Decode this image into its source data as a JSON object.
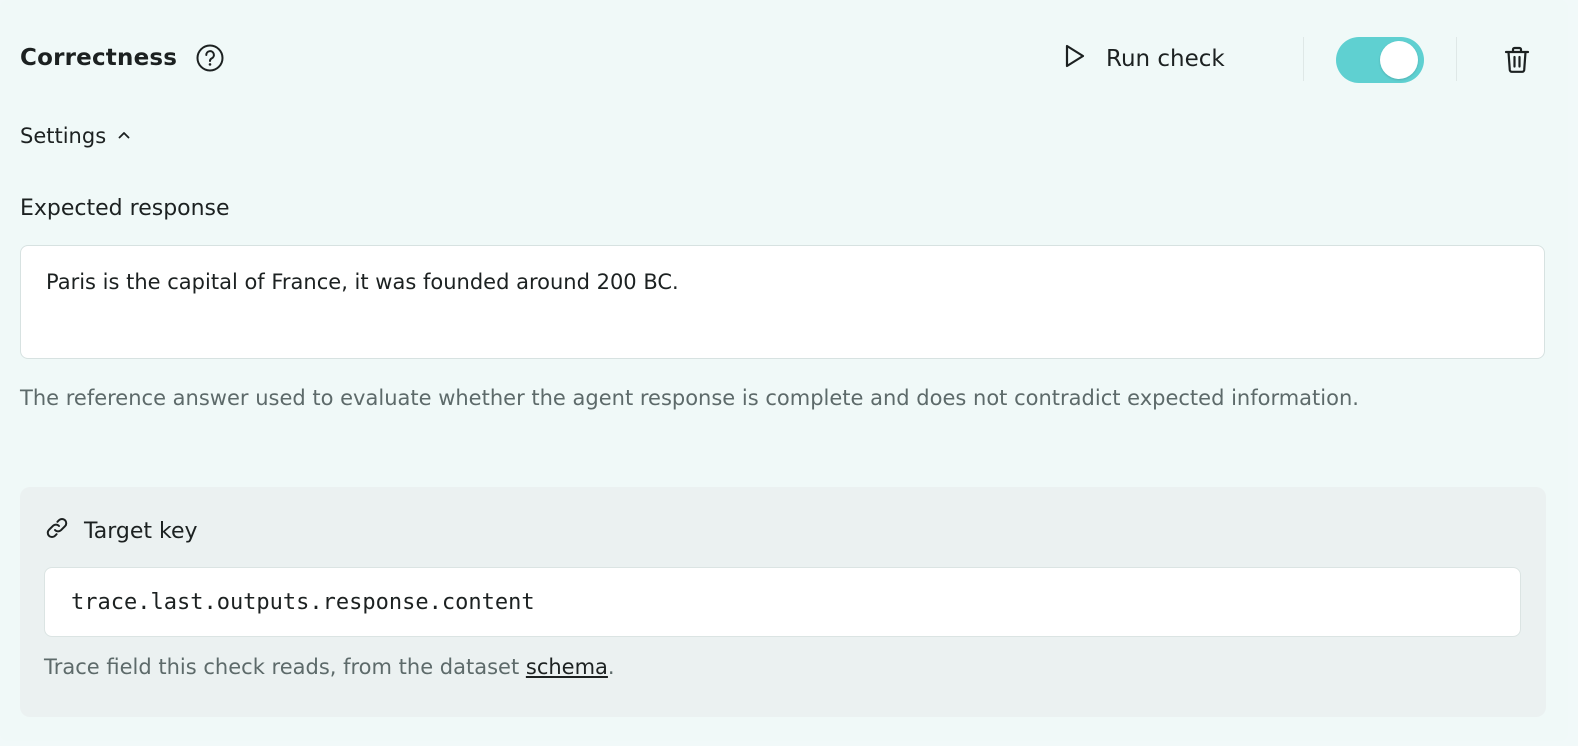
{
  "header": {
    "title": "Correctness",
    "run_check_label": "Run check",
    "toggle_on": true,
    "accent_color": "#5fd0d1"
  },
  "icons": {
    "help": "question-circle-icon",
    "run": "play-icon",
    "delete": "trash-icon",
    "settings_chevron": "chevron-up-icon",
    "target": "link-icon"
  },
  "settings": {
    "label": "Settings",
    "expanded": true
  },
  "expected_response": {
    "label": "Expected response",
    "value": "Paris is the capital of France, it was founded around 200 BC.",
    "helper": "The reference answer used to evaluate whether the agent response is complete and does not contradict expected information."
  },
  "target_key": {
    "label": "Target key",
    "value": "trace.last.outputs.response.content",
    "help_prefix": "Trace field this check reads, from the dataset ",
    "help_link": "schema",
    "help_suffix": "."
  }
}
